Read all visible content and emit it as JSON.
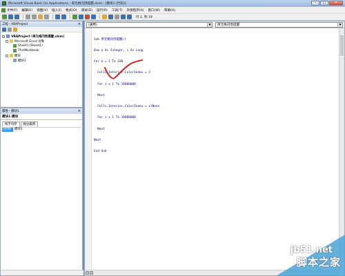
{
  "window": {
    "title": "Microsoft Visual Basic for Applications - 单元格闪烁提醒.xlsm - [模块1 (代码)]",
    "min_label": "–",
    "max_label": "□",
    "close_label": "✕"
  },
  "menubar": {
    "items": [
      {
        "label": "文件(F)"
      },
      {
        "label": "编辑(E)"
      },
      {
        "label": "视图(V)"
      },
      {
        "label": "插入(I)"
      },
      {
        "label": "格式(O)"
      },
      {
        "label": "调试(D)"
      },
      {
        "label": "运行(R)"
      },
      {
        "label": "工具(T)"
      },
      {
        "label": "外接程序(A)"
      },
      {
        "label": "窗口(W)"
      },
      {
        "label": "帮助(H)"
      }
    ]
  },
  "toolbar": {
    "position": "行 2, 列 19"
  },
  "project_pane": {
    "title": "工程 - VBAProject",
    "close_label": "×",
    "tree": {
      "project": "VBAProject (单元格闪烁提醒.xlsm)",
      "excel_objects": "Microsoft Excel 对象",
      "sheet1": "Sheet1 (Sheet1)",
      "workbook": "ThisWorkbook",
      "modules": "模块",
      "module1": "模块1"
    }
  },
  "properties_pane": {
    "title": "属性 - 模块1",
    "close_label": "×",
    "object": "模块1 模块",
    "tab_alpha": "按字母序",
    "tab_category": "按分类序",
    "row_key": "(名称)",
    "row_value": "模块1"
  },
  "code_window": {
    "object_combo": "(通用)",
    "proc_combo": "单元格闪烁提醒",
    "lines": [
      "Sub 单元格闪烁提醒()",
      "Dim a As Integer, i As Long",
      "For a = 1 To 100",
      "  Cells.Interior.ColorIndex = 3",
      "  For i = 1 To 10000000",
      "  Next",
      "  Cells.Interior.ColorIndex = xlNone",
      "  For i = 1 To 10000000",
      "  Next",
      "Next",
      "End Sub"
    ]
  },
  "watermark": {
    "site": "jb51.net",
    "name": "脚本之家"
  },
  "colors": {
    "annotation_stroke": "#d0241c",
    "code_text": "#000080"
  }
}
